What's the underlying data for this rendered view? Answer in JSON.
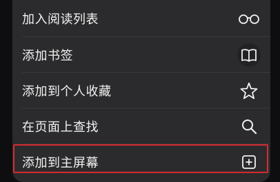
{
  "menu": {
    "items": [
      {
        "label": "加入阅读列表",
        "icon": "reading-glasses-icon"
      },
      {
        "label": "添加书签",
        "icon": "open-book-icon"
      },
      {
        "label": "添加到个人收藏",
        "icon": "star-icon"
      },
      {
        "label": "在页面上查找",
        "icon": "search-icon"
      },
      {
        "label": "添加到主屏幕",
        "icon": "plus-square-icon"
      }
    ]
  },
  "colors": {
    "menu_background": "#2b2b2d",
    "text": "#f2f2f2",
    "highlight_border": "#d62b32"
  }
}
